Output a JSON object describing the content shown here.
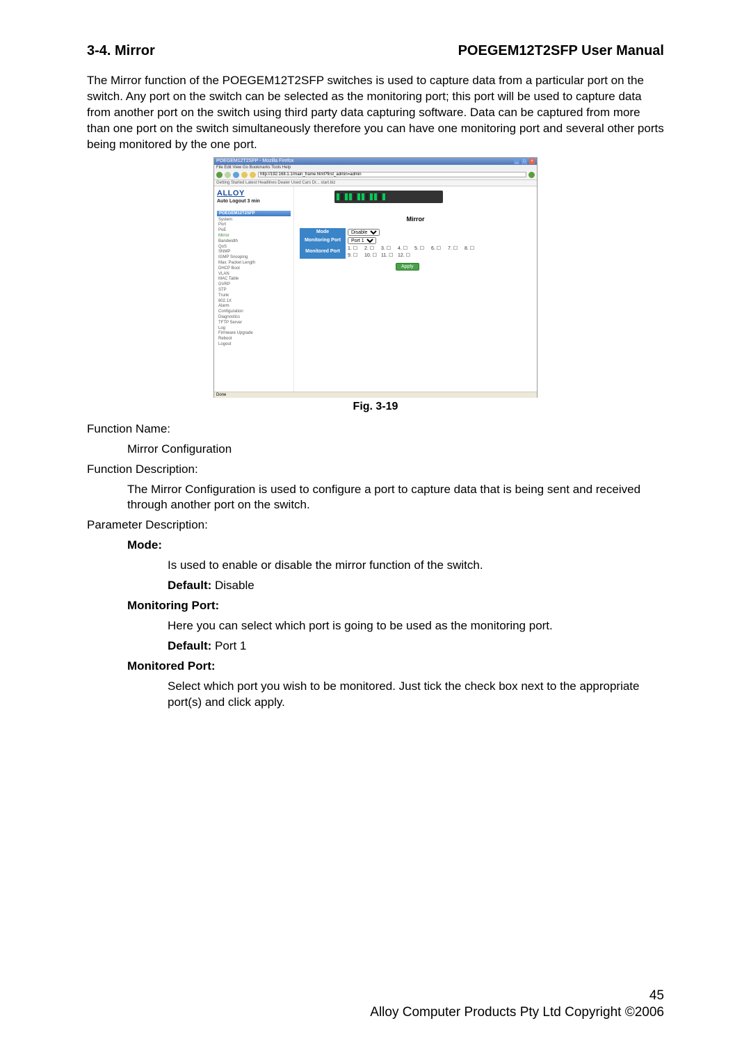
{
  "header": {
    "section_title": "3-4. Mirror",
    "manual_title": "POEGEM12T2SFP User Manual"
  },
  "intro": "The Mirror function of the POEGEM12T2SFP switches is used to capture data from a particular port on the switch. Any port on the switch can be selected as the monitoring port; this port will be used to capture data from another port on the switch using third party data capturing software. Data can be captured from more than one port on the switch simultaneously therefore you can have one monitoring port and several other ports being monitored by the one port.",
  "screenshot": {
    "window_title": "POEGEM12T2SFP - Mozilla Firefox",
    "menubar": "File  Edit  View  Go  Bookmarks  Tools  Help",
    "url": "http://192.168.1.1/main_frame.html?first_admin=admin",
    "bookmarks": "Getting Started   Latest Headlines   Dealer Used Cars Dr...   start.biz",
    "logo": "ALLOY",
    "auto_logout_label": "Auto Logout  3 min",
    "nav_header": "POEGEM12T2SFP",
    "nav": [
      "System",
      "Port",
      "PoE",
      "Mirror",
      "Bandwidth",
      "QoS",
      "SNMP",
      "IGMP Snooping",
      "Max. Packet Length",
      "DHCP Boot",
      "VLAN",
      "MAC Table",
      "GVRP",
      "STP",
      "Trunk",
      "802.1X",
      "Alarm",
      "Configuration",
      "Diagnostics",
      "TFTP Server",
      "Log",
      "Firmware Upgrade",
      "Reboot",
      "Logout"
    ],
    "nav_active_index": 3,
    "panel_heading": "Mirror",
    "table": {
      "mode_label": "Mode",
      "mode_value": "Disable",
      "monitoring_port_label": "Monitoring Port",
      "monitoring_port_value": "Port 1",
      "monitored_port_label": "Monitored Port",
      "port_row1": [
        "1.",
        "2.",
        "3.",
        "4.",
        "5.",
        "6.",
        "7.",
        "8."
      ],
      "port_row2": [
        "9.",
        "10.",
        "11.",
        "12."
      ]
    },
    "apply_label": "Apply",
    "status_text": "Done"
  },
  "figcap": "Fig. 3-19",
  "fn_name_label": "Function Name:",
  "fn_name_value": "Mirror Configuration",
  "fn_desc_label": "Function Description:",
  "fn_desc_value": "The Mirror Configuration is used to configure a port to capture data that is being sent and received through another port on the switch.",
  "param_desc_label": "Parameter Description:",
  "params": {
    "mode": {
      "label": "Mode:",
      "text": "Is used to enable or disable the mirror function of the switch.",
      "default_label": "Default:",
      "default_value": " Disable"
    },
    "monitoring": {
      "label": "Monitoring Port:",
      "text": "Here you can select which port is going to be used as the monitoring port.",
      "default_label": "Default:",
      "default_value": " Port 1"
    },
    "monitored": {
      "label": "Monitored Port:",
      "text": "Select which port you wish to be monitored. Just tick the check box next to the appropriate port(s) and click apply."
    }
  },
  "footer": {
    "page_number": "45",
    "copyright": "Alloy Computer Products Pty Ltd Copyright ©2006"
  }
}
